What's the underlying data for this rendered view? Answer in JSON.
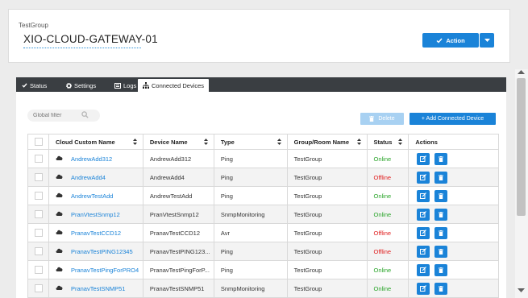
{
  "header": {
    "group_label": "TestGroup",
    "gateway_name": "XIO-CLOUD-GATEWAY-01",
    "action_label": "Action"
  },
  "tabs": [
    {
      "label": "Status",
      "icon": "check-icon"
    },
    {
      "label": "Settings",
      "icon": "gear-icon"
    },
    {
      "label": "Logs",
      "icon": "list-icon"
    },
    {
      "label": "Connected Devices",
      "icon": "sitemap-icon"
    }
  ],
  "toolbar": {
    "filter_placeholder": "Global filter",
    "delete_label": "Delete",
    "add_label": "+ Add Connected Device"
  },
  "table": {
    "columns": [
      "Cloud Custom Name",
      "Device Name",
      "Type",
      "Group/Room Name",
      "Status",
      "Actions"
    ],
    "rows": [
      {
        "cloud_name": "AndrewAdd312",
        "device_name": "AndrewAdd312",
        "type": "Ping",
        "group": "TestGroup",
        "status": "Online"
      },
      {
        "cloud_name": "AndrewAdd4",
        "device_name": "AndrewAdd4",
        "type": "Ping",
        "group": "TestGroup",
        "status": "Offline"
      },
      {
        "cloud_name": "AndrewTestAdd",
        "device_name": "AndrewTestAdd",
        "type": "Ping",
        "group": "TestGroup",
        "status": "Online"
      },
      {
        "cloud_name": "PranVtestSnmp12",
        "device_name": "PranVtestSnmp12",
        "type": "SnmpMonitoring",
        "group": "TestGroup",
        "status": "Online"
      },
      {
        "cloud_name": "PranavTestCCD12",
        "device_name": "PranavTestCCD12",
        "type": "Avr",
        "group": "TestGroup",
        "status": "Offline"
      },
      {
        "cloud_name": "PranavTestPING12345",
        "device_name": "PranavTestPING123...",
        "type": "Ping",
        "group": "TestGroup",
        "status": "Offline"
      },
      {
        "cloud_name": "PranavTestPingForPRO4",
        "device_name": "PranavTestPingForP...",
        "type": "Ping",
        "group": "TestGroup",
        "status": "Online"
      },
      {
        "cloud_name": "PranavTestSNMP51",
        "device_name": "PranavTestSNMP51",
        "type": "SnmpMonitoring",
        "group": "TestGroup",
        "status": "Online"
      }
    ]
  },
  "colors": {
    "accent": "#1a83d8",
    "online": "#2aa52a",
    "offline": "#e02020",
    "tabbar": "#3a3e42"
  }
}
